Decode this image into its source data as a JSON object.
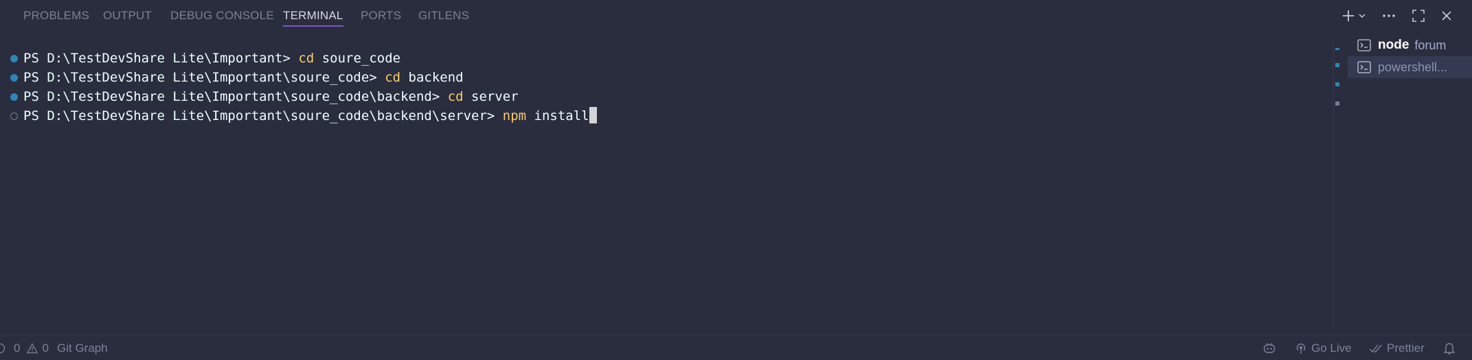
{
  "tabs": [
    {
      "label": "PROBLEMS"
    },
    {
      "label": "OUTPUT"
    },
    {
      "label": "DEBUG CONSOLE"
    },
    {
      "label": "TERMINAL",
      "active": true
    },
    {
      "label": "PORTS"
    },
    {
      "label": "GITLENS"
    }
  ],
  "toolbar": {
    "icons": [
      "plus-icon",
      "chevron-down-icon",
      "ellipsis-icon",
      "maximize-icon",
      "close-icon"
    ]
  },
  "terminal": {
    "lines": [
      {
        "prompt": "PS D:\\TestDevShare Lite\\Important> ",
        "cmd": "cd",
        "args": " soure_code",
        "status": "success"
      },
      {
        "prompt": "PS D:\\TestDevShare Lite\\Important\\soure_code> ",
        "cmd": "cd",
        "args": " backend",
        "status": "success"
      },
      {
        "prompt": "PS D:\\TestDevShare Lite\\Important\\soure_code\\backend> ",
        "cmd": "cd",
        "args": " server",
        "status": "success"
      },
      {
        "prompt": "PS D:\\TestDevShare Lite\\Important\\soure_code\\backend\\server> ",
        "cmd": "npm",
        "args": " install",
        "status": "pending"
      }
    ]
  },
  "terminal_list": [
    {
      "name": "node",
      "detail": "forum",
      "selected": false
    },
    {
      "name": "",
      "detail": "powershell...",
      "selected": true
    }
  ],
  "statusbar": {
    "errors": "0",
    "warnings": "0",
    "git_graph": "Git Graph",
    "go_live": "Go Live",
    "prettier": "Prettier"
  },
  "colors": {
    "background": "#292d3e",
    "accent": "#7e57c2",
    "command": "#ffcb6b",
    "success_dot": "#2e86b8"
  }
}
